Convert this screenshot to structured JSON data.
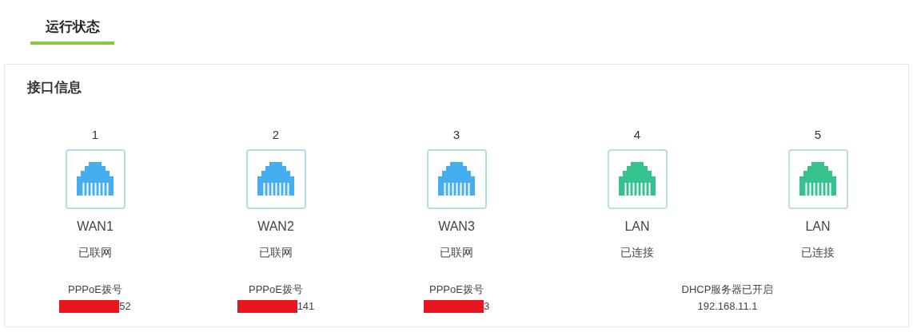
{
  "tabs": [
    {
      "label": "运行状态",
      "selected": true
    }
  ],
  "section": {
    "title": "接口信息",
    "ports": [
      {
        "number": "1",
        "kind": "wan",
        "name": "WAN1",
        "status": "已联网",
        "detail": "PPPoE拨号",
        "address": "52",
        "redacted": true
      },
      {
        "number": "2",
        "kind": "wan",
        "name": "WAN2",
        "status": "已联网",
        "detail": "PPPoE拨号",
        "address": "141",
        "redacted": true
      },
      {
        "number": "3",
        "kind": "wan",
        "name": "WAN3",
        "status": "已联网",
        "detail": "PPPoE拨号",
        "address": "3",
        "redacted": true
      },
      {
        "number": "4",
        "kind": "lan",
        "name": "LAN",
        "status": "已连接"
      },
      {
        "number": "5",
        "kind": "lan",
        "name": "LAN",
        "status": "已连接"
      }
    ],
    "dhcp": {
      "label": "DHCP服务器已开启",
      "address": "192.168.11.1"
    }
  }
}
